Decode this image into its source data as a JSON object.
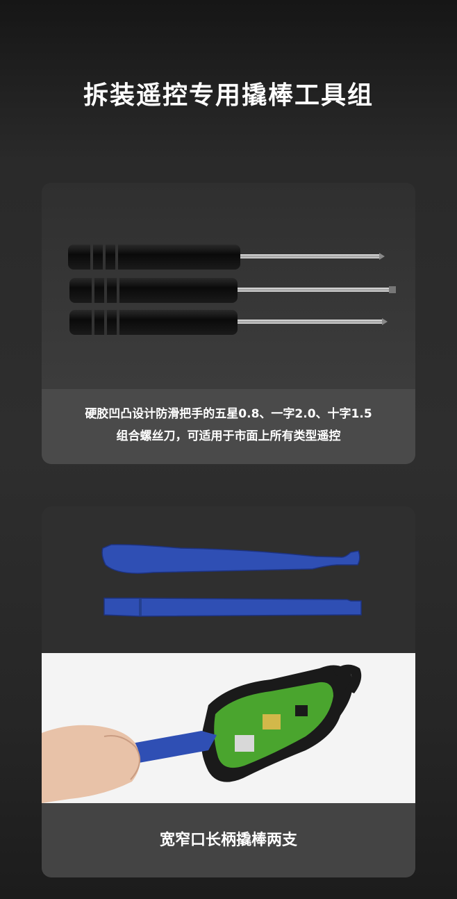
{
  "title": "拆装遥控专用撬棒工具组",
  "card1": {
    "caption_line1": "硬胶凹凸设计防滑把手的五星0.8、一字2.0、十字1.5",
    "caption_line2": "组合螺丝刀，可适用于市面上所有类型遥控"
  },
  "card2": {
    "caption": "宽窄口长柄撬棒两支"
  },
  "colors": {
    "tool_blue": "#2f4fb4",
    "handle_black": "#0d0d0d",
    "pcb_green": "#4aa52e"
  }
}
